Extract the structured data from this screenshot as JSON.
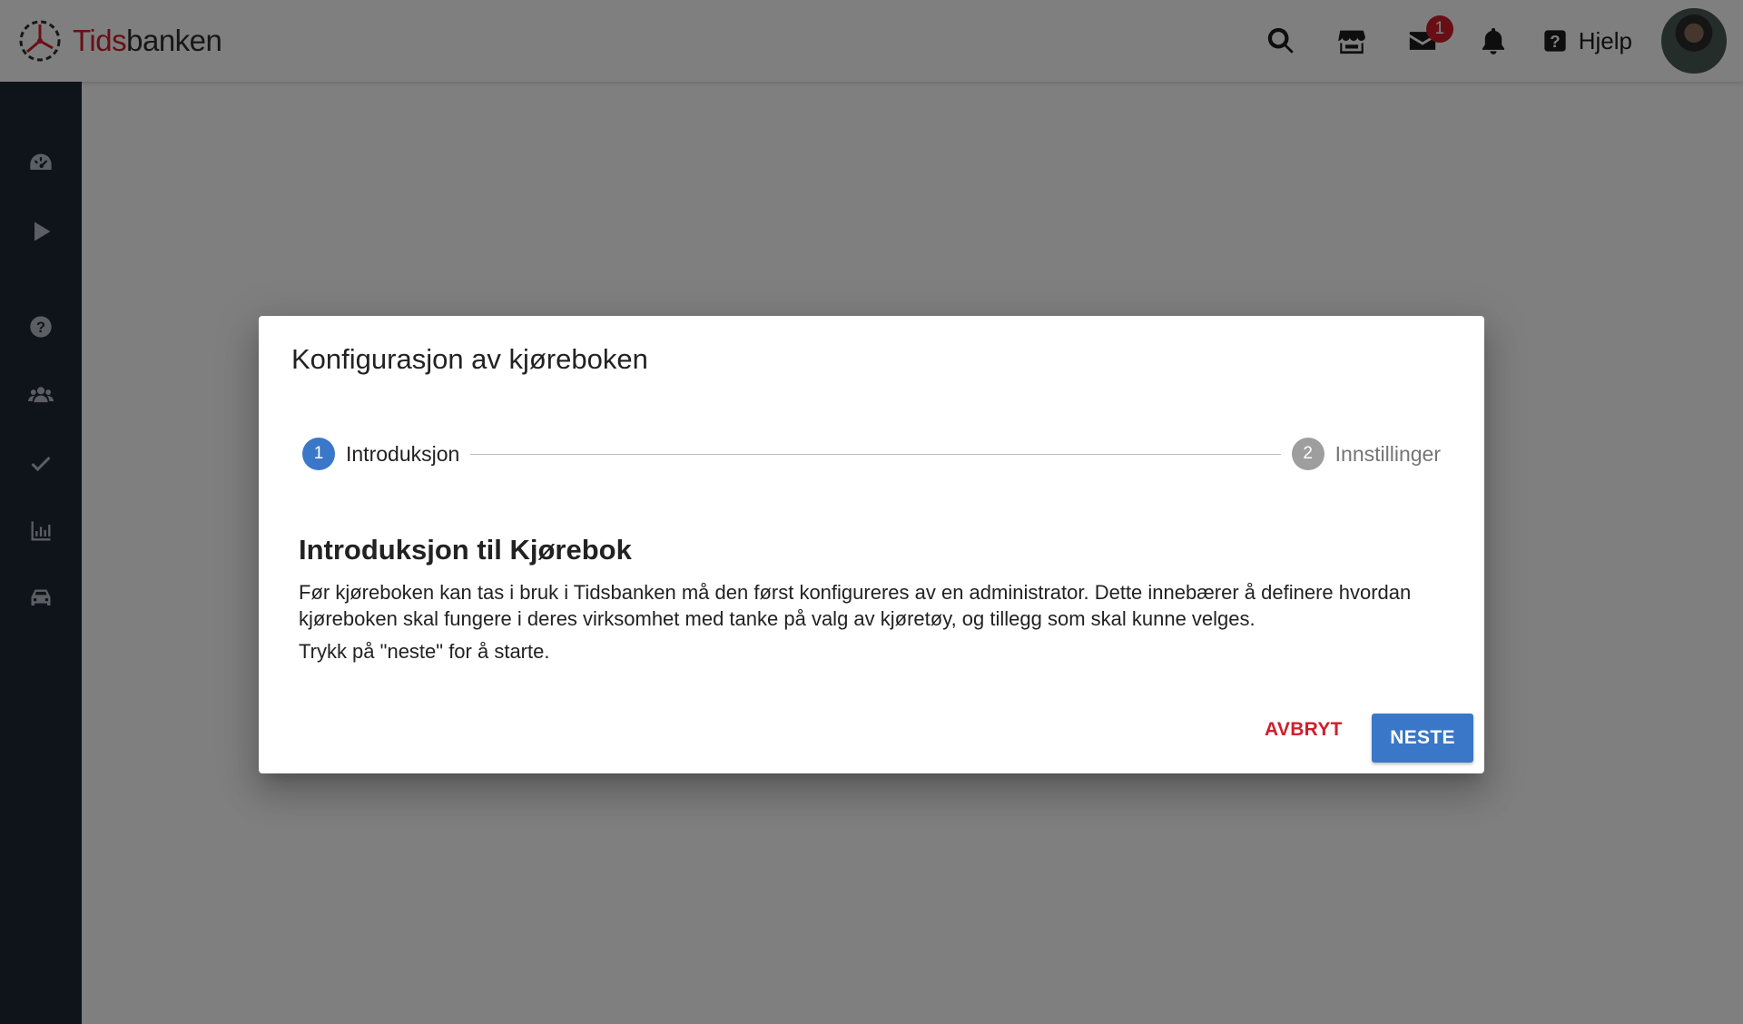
{
  "brand": {
    "name_part1": "Tids",
    "name_part2": "banken",
    "accent_color": "#d01e2b"
  },
  "topbar": {
    "icons": [
      "search-icon",
      "store-icon",
      "mail-icon",
      "bell-icon"
    ],
    "mail_badge": "1",
    "help_label": "Hjelp"
  },
  "sidebar": {
    "items": [
      "dashboard-icon",
      "play-icon",
      "help-circle-icon",
      "users-icon",
      "check-icon",
      "chart-icon",
      "car-icon"
    ]
  },
  "dialog": {
    "title": "Konfigurasjon av kjøreboken",
    "steps": [
      {
        "number": "1",
        "label": "Introduksjon",
        "state": "active"
      },
      {
        "number": "2",
        "label": "Innstillinger",
        "state": "inactive"
      }
    ],
    "heading": "Introduksjon til Kjørebok",
    "body": "Før kjøreboken kan tas i bruk i Tidsbanken må den først konfigureres av en administrator. Dette innebærer å definere hvordan kjøreboken skal fungere i deres virksomhet med tanke på valg av kjøretøy, og tillegg som skal kunne velges.",
    "hint": "Trykk på \"neste\" for å starte.",
    "cancel_label": "AVBRYT",
    "next_label": "NESTE",
    "primary_color": "#3a77c8"
  }
}
